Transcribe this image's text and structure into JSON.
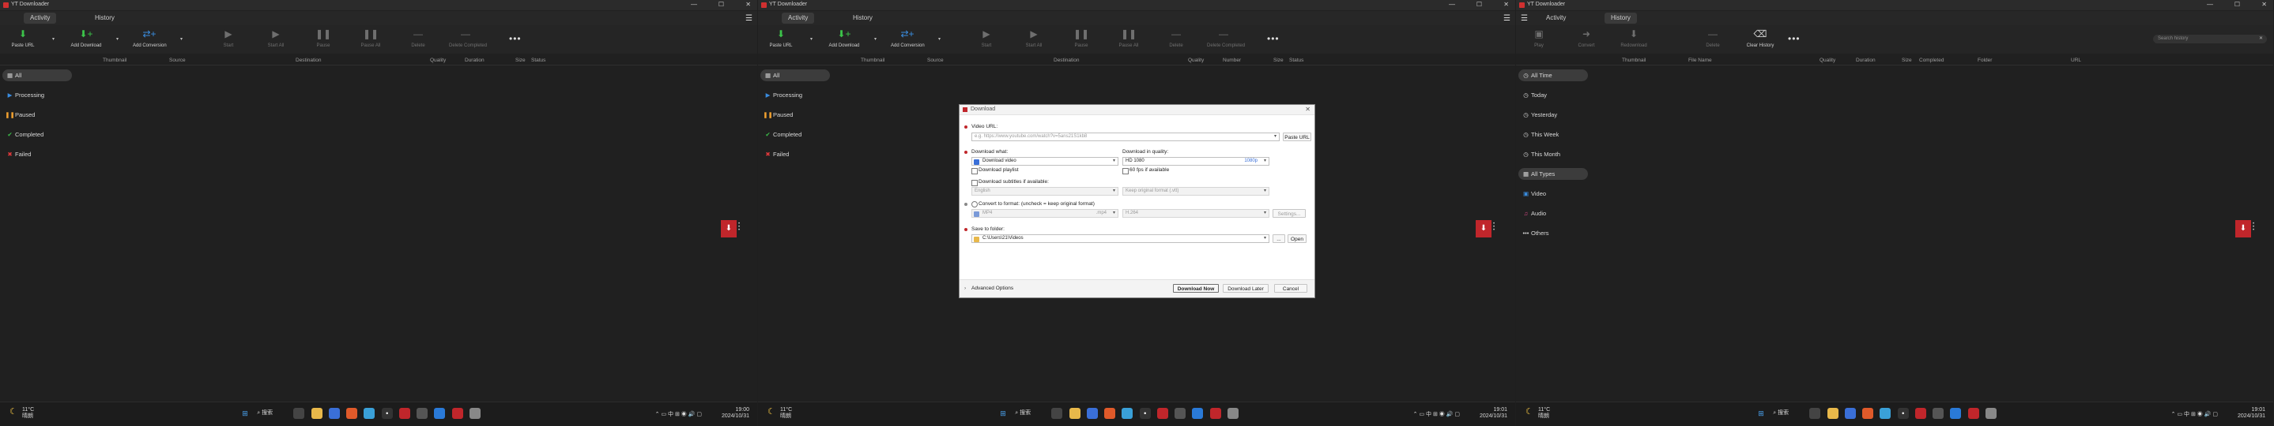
{
  "app": {
    "title": "YT Downloader",
    "tabs": [
      "Activity",
      "History"
    ],
    "window_controls": {
      "minimize": "—",
      "maximize": "☐",
      "close": "✕"
    },
    "menu_icon": "hamburger-icon"
  },
  "toolbar_activity": [
    {
      "label": "Paste URL",
      "icon": "paste-url-icon"
    },
    {
      "label": "Add Download",
      "icon": "add-download-icon"
    },
    {
      "label": "Add Conversion",
      "icon": "add-conversion-icon"
    },
    {
      "label": "Start",
      "icon": "play-icon"
    },
    {
      "label": "Start All",
      "icon": "play-all-icon"
    },
    {
      "label": "Pause",
      "icon": "pause-icon"
    },
    {
      "label": "Pause All",
      "icon": "pause-all-icon"
    },
    {
      "label": "Delete",
      "icon": "delete-icon"
    },
    {
      "label": "Delete Completed",
      "icon": "delete-completed-icon"
    }
  ],
  "toolbar_history": [
    {
      "label": "Play",
      "icon": "play-icon"
    },
    {
      "label": "Convert",
      "icon": "convert-icon"
    },
    {
      "label": "Redownload",
      "icon": "redownload-icon"
    },
    {
      "label": "Delete",
      "icon": "delete-icon"
    },
    {
      "label": "Clear History",
      "icon": "clear-history-icon"
    }
  ],
  "more_label": "•••",
  "search_history": {
    "placeholder": "Search history",
    "clear": "✕"
  },
  "columns_p1": [
    "Thumbnail",
    "Source",
    "Destination",
    "Quality",
    "Duration",
    "Size",
    "Status"
  ],
  "columns_p2": [
    "Thumbnail",
    "Source",
    "Destination",
    "Quality",
    "Number",
    "Size",
    "Status"
  ],
  "columns_p3": [
    "Thumbnail",
    "File Name",
    "Quality",
    "Duration",
    "Size",
    "Completed",
    "Folder",
    "URL"
  ],
  "sidebar_activity": [
    {
      "label": "All",
      "icon": "grid-icon",
      "selected": true
    },
    {
      "label": "Processing",
      "icon": "processing-icon"
    },
    {
      "label": "Paused",
      "icon": "pause-icon"
    },
    {
      "label": "Completed",
      "icon": "check-icon"
    },
    {
      "label": "Failed",
      "icon": "x-icon"
    }
  ],
  "sidebar_history_time": [
    {
      "label": "All Time",
      "icon": "clock-icon",
      "selected": true
    },
    {
      "label": "Today",
      "icon": "clock-icon"
    },
    {
      "label": "Yesterday",
      "icon": "clock-icon"
    },
    {
      "label": "This Week",
      "icon": "clock-icon"
    },
    {
      "label": "This Month",
      "icon": "clock-icon"
    }
  ],
  "sidebar_history_types": [
    {
      "label": "All Types",
      "icon": "grid-icon",
      "selected": true
    },
    {
      "label": "Video",
      "icon": "video-icon"
    },
    {
      "label": "Audio",
      "icon": "music-icon"
    },
    {
      "label": "Others",
      "icon": "dots-icon"
    }
  ],
  "dialog": {
    "title": "Download",
    "close": "✕",
    "video_url_label": "Video URL:",
    "video_url_placeholder": "e.g. https://www.youtube.com/watch?v=5ans21S1kb8",
    "paste_url_btn": "Paste URL",
    "download_what_label": "Download what:",
    "download_what_value": "Download video",
    "quality_label": "Download in quality:",
    "quality_value": "HD 1080",
    "quality_badge": "1080p",
    "download_playlist": "Download playlist",
    "fps60": "60 fps if available",
    "subtitles": "Download subtitles if available:",
    "subtitle_lang": "English",
    "subtitle_format": "Keep original format (.vtt)",
    "convert_label": "Convert to format: (uncheck = keep original format)",
    "convert_format": "MP4",
    "convert_ext": ".mp4",
    "convert_codec": "H.264",
    "settings_btn": "Settings...",
    "save_label": "Save to folder:",
    "save_path": "C:\\Users\\21\\Videos",
    "browse_btn": "...",
    "open_btn": "Open",
    "advanced": "Advanced Options",
    "download_now": "Download Now",
    "download_later": "Download Later",
    "cancel": "Cancel"
  },
  "taskbar": {
    "weather_temp": "11°C",
    "weather_desc": "晴朗",
    "search_label": "搜索",
    "clock_time_1": "19:00",
    "clock_time_2": "19:01",
    "clock_date": "2024/10/31",
    "tray_lang": "中"
  },
  "colors": {
    "accent_red": "#c0262b",
    "green_add": "#3cc34a",
    "blue_conversion": "#3a8de0",
    "processing_blue": "#3a8de0",
    "paused_orange": "#f0a030",
    "completed_green": "#3cc34a",
    "failed_red": "#e0383b"
  }
}
